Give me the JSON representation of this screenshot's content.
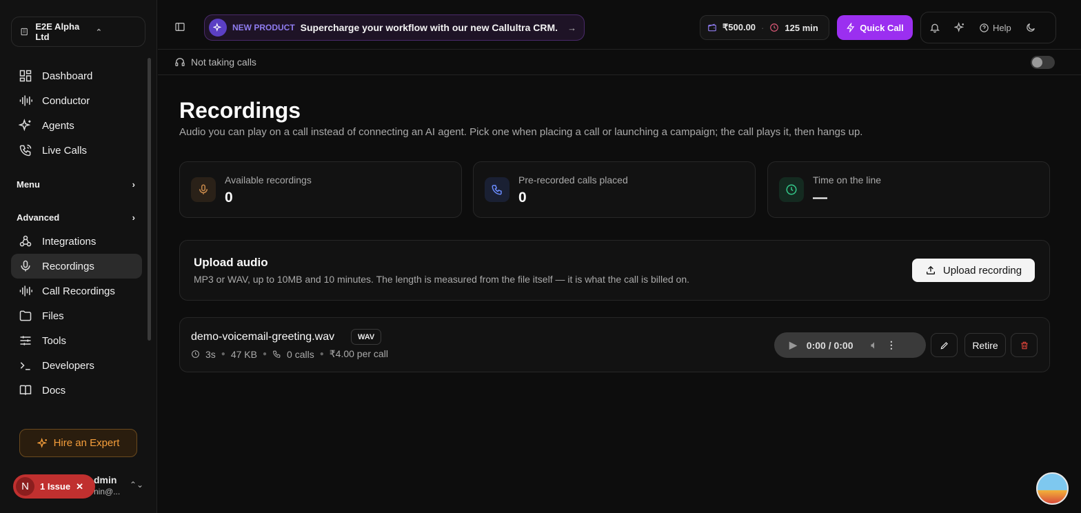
{
  "org": {
    "name": "E2E Alpha Ltd"
  },
  "sidebar": {
    "items_top": [
      {
        "label": "Dashboard",
        "icon": "dashboard-icon"
      },
      {
        "label": "Conductor",
        "icon": "waveform-icon"
      },
      {
        "label": "Agents",
        "icon": "sparkles-icon"
      },
      {
        "label": "Live Calls",
        "icon": "phone-call-icon"
      }
    ],
    "menu_label": "Menu",
    "advanced_label": "Advanced",
    "items_advanced": [
      {
        "label": "Integrations",
        "icon": "webhook-icon"
      },
      {
        "label": "Recordings",
        "icon": "mic-icon",
        "active": true
      },
      {
        "label": "Call Recordings",
        "icon": "waveform-icon"
      },
      {
        "label": "Files",
        "icon": "folder-icon"
      },
      {
        "label": "Tools",
        "icon": "sliders-icon"
      },
      {
        "label": "Developers",
        "icon": "terminal-icon"
      },
      {
        "label": "Docs",
        "icon": "book-icon"
      }
    ],
    "hire_label": "Hire an Expert",
    "user_name": "dmin",
    "user_email": "nin@..."
  },
  "issue": {
    "letter": "N",
    "label": "1 Issue"
  },
  "topbar": {
    "promo_tag": "NEW PRODUCT",
    "promo_message": "Supercharge your workflow with our new Callultra CRM.",
    "balance": "₹500.00",
    "minutes": "125 min",
    "quick_call": "Quick Call",
    "help": "Help"
  },
  "status": {
    "text": "Not taking calls"
  },
  "page": {
    "title": "Recordings",
    "subtitle": "Audio you can play on a call instead of connecting an AI agent. Pick one when placing a call or launching a campaign; the call plays it, then hangs up."
  },
  "stats": [
    {
      "label": "Available recordings",
      "value": "0",
      "icon": "mic-icon",
      "color": "#c98a4b"
    },
    {
      "label": "Pre-recorded calls placed",
      "value": "0",
      "icon": "phone-icon",
      "color": "#6b8cff"
    },
    {
      "label": "Time on the line",
      "value": "—",
      "icon": "clock-icon",
      "color": "#34c98a"
    }
  ],
  "upload": {
    "title": "Upload audio",
    "description": "MP3 or WAV, up to 10MB and 10 minutes. The length is measured from the file itself — it is what the call is billed on.",
    "button": "Upload recording"
  },
  "recording": {
    "filename": "demo-voicemail-greeting.wav",
    "format": "WAV",
    "duration": "3s",
    "size": "47 KB",
    "calls": "0 calls",
    "price": "₹4.00 per call",
    "player_time": "0:00 / 0:00",
    "retire_label": "Retire"
  },
  "colors": {
    "accent": "#9b2ff0",
    "danger": "#e0443a"
  }
}
